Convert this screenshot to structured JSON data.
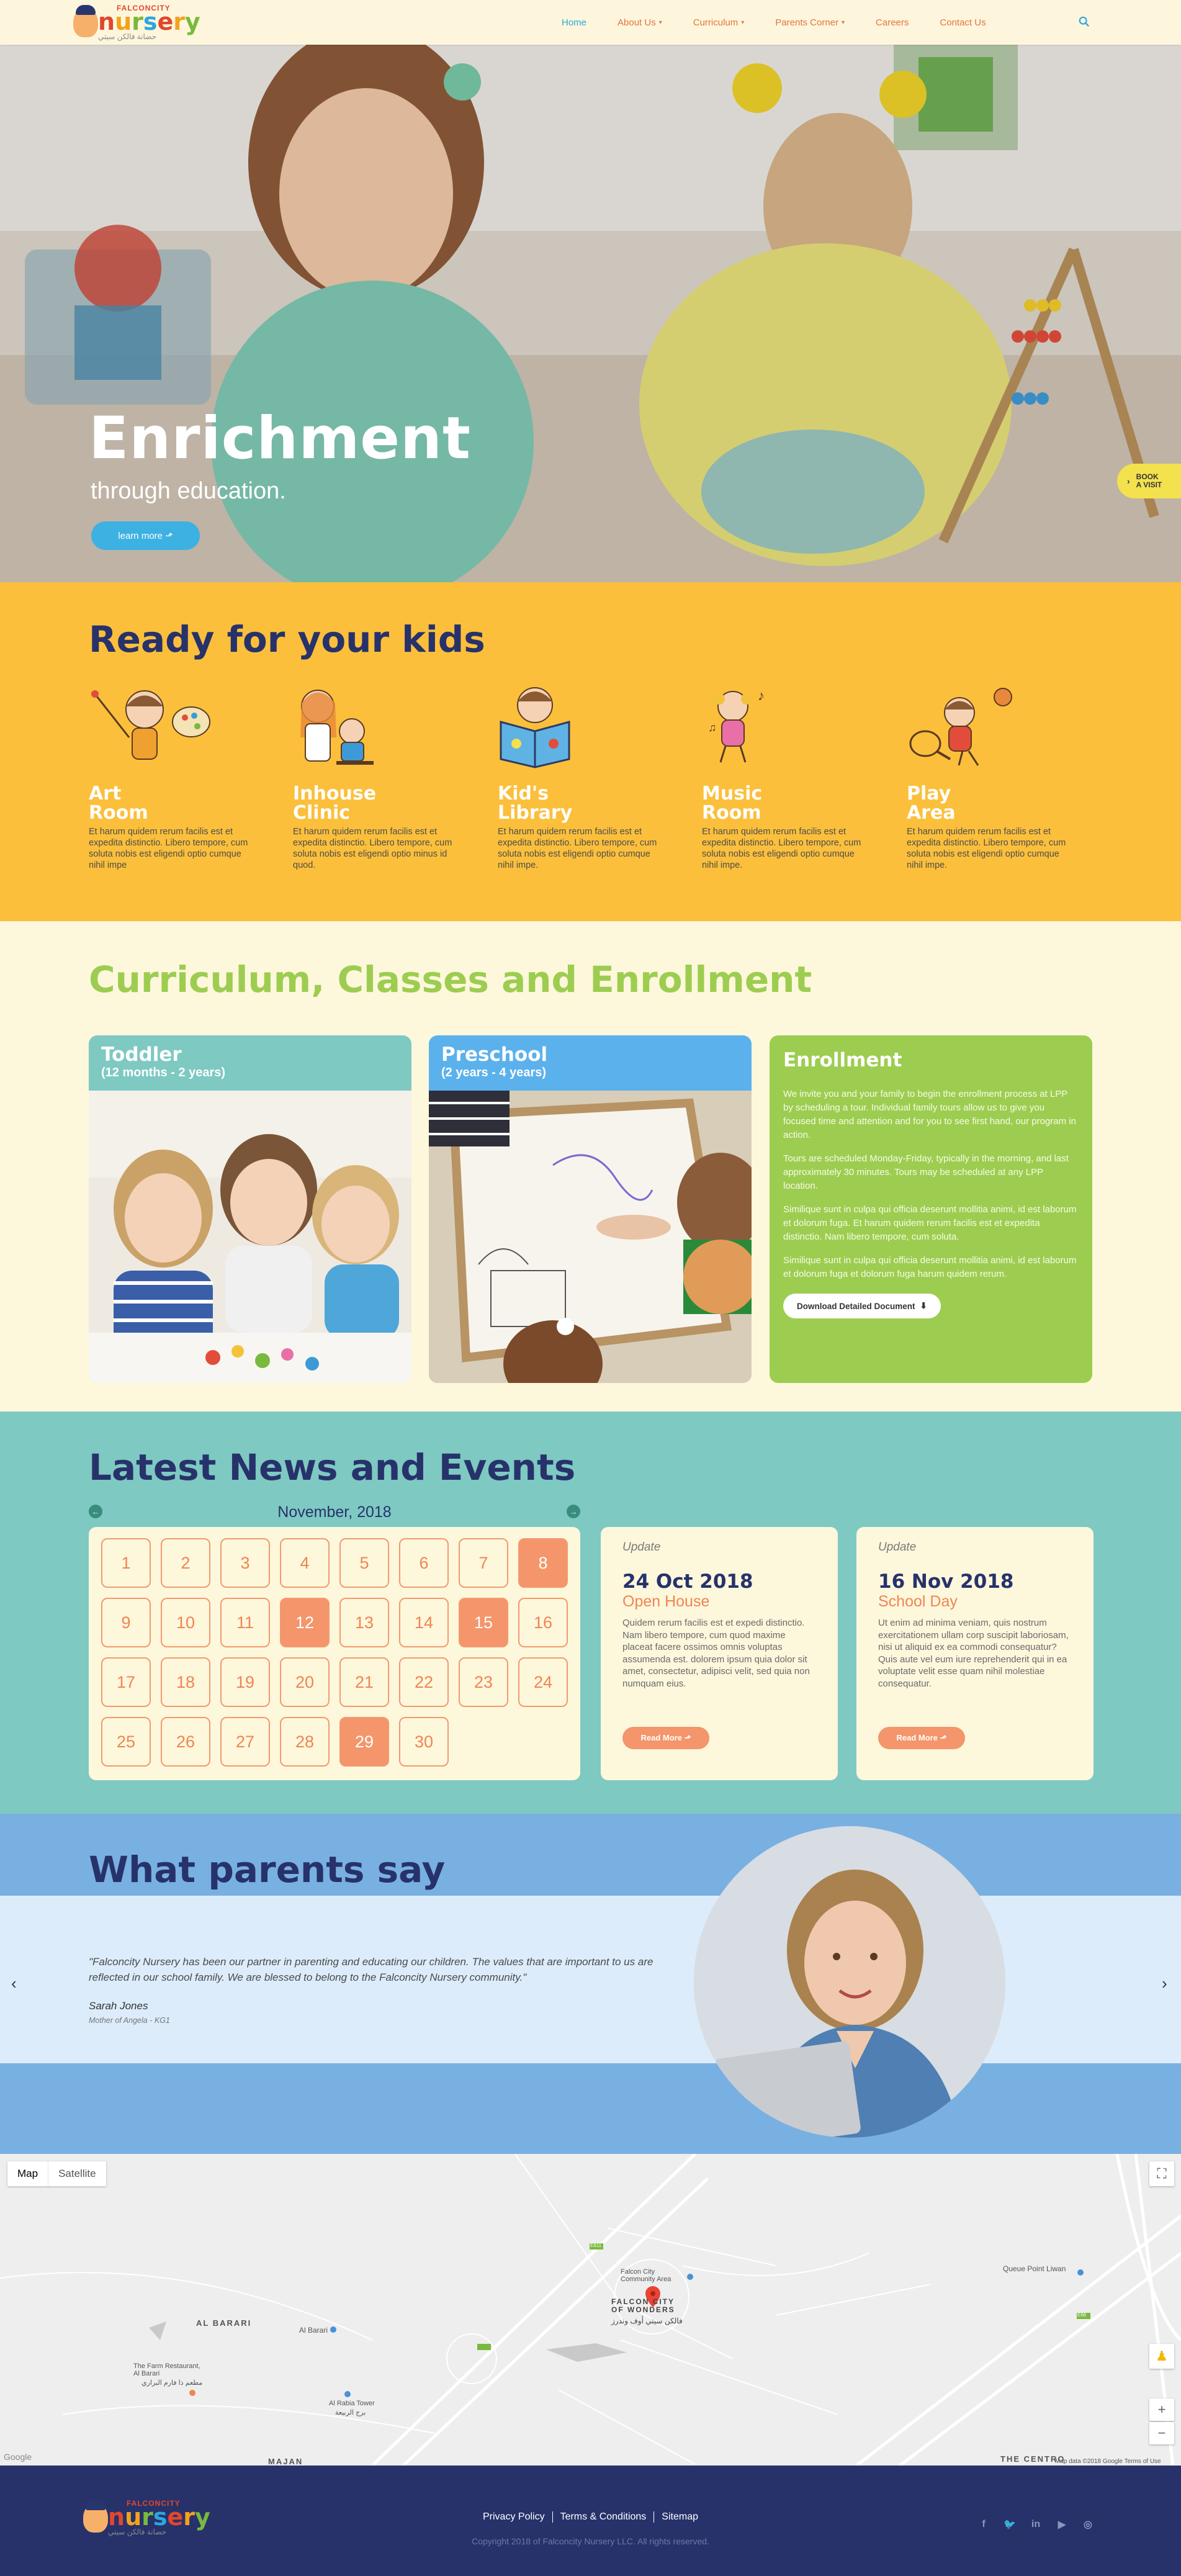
{
  "header": {
    "logo": {
      "top": "FALCONCITY",
      "main": "nursery",
      "sub": "حضانة فالكن سيتي"
    },
    "nav": [
      {
        "label": "Home",
        "active": true,
        "dropdown": false
      },
      {
        "label": "About Us",
        "active": false,
        "dropdown": true
      },
      {
        "label": "Curriculum",
        "active": false,
        "dropdown": true
      },
      {
        "label": "Parents Corner",
        "active": false,
        "dropdown": true
      },
      {
        "label": "Careers",
        "active": false,
        "dropdown": false
      },
      {
        "label": "Contact Us",
        "active": false,
        "dropdown": false
      }
    ],
    "search_icon": "search-icon"
  },
  "hero": {
    "title": "Enrichment",
    "subtitle": "through education.",
    "button": "learn more ⬏",
    "book_visit": [
      "BOOK",
      "A VISIT"
    ]
  },
  "ready": {
    "title": "Ready for your kids",
    "features": [
      {
        "title1": "Art",
        "title2": "Room",
        "text": "Et harum quidem rerum facilis est et expedita distinctio. Libero tempore, cum soluta nobis est eligendi optio cumque nihil impe"
      },
      {
        "title1": "Inhouse",
        "title2": "Clinic",
        "text": "Et harum quidem rerum facilis est et expedita distinctio. Libero tempore, cum soluta nobis est eligendi optio minus id quod."
      },
      {
        "title1": "Kid's",
        "title2": "Library",
        "text": "Et harum quidem rerum facilis est et expedita distinctio. Libero tempore, cum soluta nobis est eligendi optio cumque nihil impe."
      },
      {
        "title1": "Music",
        "title2": "Room",
        "text": "Et harum quidem rerum facilis est et expedita distinctio. Libero tempore, cum soluta nobis est eligendi optio cumque nihil impe."
      },
      {
        "title1": "Play",
        "title2": "Area",
        "text": "Et harum quidem rerum facilis est et expedita distinctio. Libero tempore, cum soluta nobis est eligendi optio cumque nihil impe."
      }
    ]
  },
  "curriculum": {
    "title": "Curriculum, Classes and Enrollment",
    "toddler": {
      "title": "Toddler",
      "subtitle": "(12 months - 2 years)"
    },
    "preschool": {
      "title": "Preschool",
      "subtitle": "(2 years - 4 years)"
    },
    "enrollment": {
      "title": "Enrollment",
      "p1": "We invite you and your family to begin the enrollment process at LPP by scheduling a tour. Individual family tours allow us to give you focused time and attention and for you to see first hand, our program in action.",
      "p2": "Tours are scheduled Monday-Friday, typically in the morning, and last approximately 30 minutes. Tours may be scheduled at any LPP location.",
      "p3": "Similique sunt in culpa qui officia deserunt mollitia animi, id est laborum et dolorum fuga. Et harum quidem rerum facilis est et expedita distinctio. Nam libero tempore, cum soluta.",
      "p4": "Similique sunt in culpa qui officia deserunt mollitia animi, id est laborum et dolorum fuga et dolorum fuga harum quidem rerum.",
      "button": "Download Detailed Document"
    }
  },
  "news": {
    "title": "Latest News and Events",
    "calendar": {
      "month": "November, 2018",
      "days": [
        "1",
        "2",
        "3",
        "4",
        "5",
        "6",
        "7",
        "8",
        "9",
        "10",
        "11",
        "12",
        "13",
        "14",
        "15",
        "16",
        "17",
        "18",
        "19",
        "20",
        "21",
        "22",
        "23",
        "24",
        "25",
        "26",
        "27",
        "28",
        "29",
        "30"
      ],
      "highlighted": [
        "8",
        "12",
        "15",
        "29"
      ]
    },
    "cards": [
      {
        "label": "Update",
        "date": "24 Oct 2018",
        "event": "Open House",
        "text": "Quidem rerum facilis est et expedi distinctio. Nam libero tempore, cum quod maxime placeat facere ossimos omnis voluptas assumenda est. dolorem ipsum quia dolor sit amet, consectetur, adipisci velit, sed quia non numquam eius.",
        "button": "Read More ⬏"
      },
      {
        "label": "Update",
        "date": "16 Nov 2018",
        "event": "School Day",
        "text": "Ut enim ad minima veniam, quis nostrum exercitationem ullam corp suscipit laboriosam, nisi ut aliquid ex ea commodi consequatur? Quis aute vel eum iure reprehenderit qui in ea voluptate velit esse quam nihil molestiae consequatur.",
        "button": "Read More ⬏"
      }
    ]
  },
  "testimonial": {
    "title": "What parents say",
    "quote": "\"Falconcity Nursery has been our partner in parenting and educating our children. The values that are important to us are reflected in our school family. We are blessed to belong to the Falconcity Nursery community.\"",
    "name": "Sarah Jones",
    "role": "Mother of Angela - KG1"
  },
  "map": {
    "tabs": [
      "Map",
      "Satellite"
    ],
    "labels": {
      "al_barari": "AL BARARI",
      "majan": "MAJAN",
      "centro": "THE CENTRO",
      "falcon_area": "Falcon City Community Area",
      "fcow": "FALCON CITY OF WONDERS",
      "fcow_ar": "فالكن سيتي أوف وندرز",
      "queue": "Queue Point Liwan",
      "barari_pin": "Al Barari",
      "farm": "The Farm Restaurant, Al Barari",
      "farm_ar": "مطعم ذا فارم البراري",
      "rabia": "Al Rabia Tower",
      "rabia_ar": "برج الربيعة",
      "road_e611": "E611",
      "road_e66": "E66",
      "google": "Google",
      "attribution": "Map data ©2018 Google   Terms of Use"
    }
  },
  "footer": {
    "links": [
      "Privacy Policy",
      "Terms & Conditions",
      "Sitemap"
    ],
    "copyright": "Copyright 2018 of Falconcity Nursery LLC. All rights reserved.",
    "social": [
      "facebook-icon",
      "twitter-icon",
      "linkedin-icon",
      "youtube-icon",
      "instagram-icon"
    ]
  },
  "colors": {
    "navy": "#27326b",
    "orange": "#f08552",
    "yellow": "#fbbf3b",
    "green": "#9dcd50",
    "teal": "#7ec9c2",
    "blue": "#79b0e2",
    "link": "#2ea6dd"
  }
}
